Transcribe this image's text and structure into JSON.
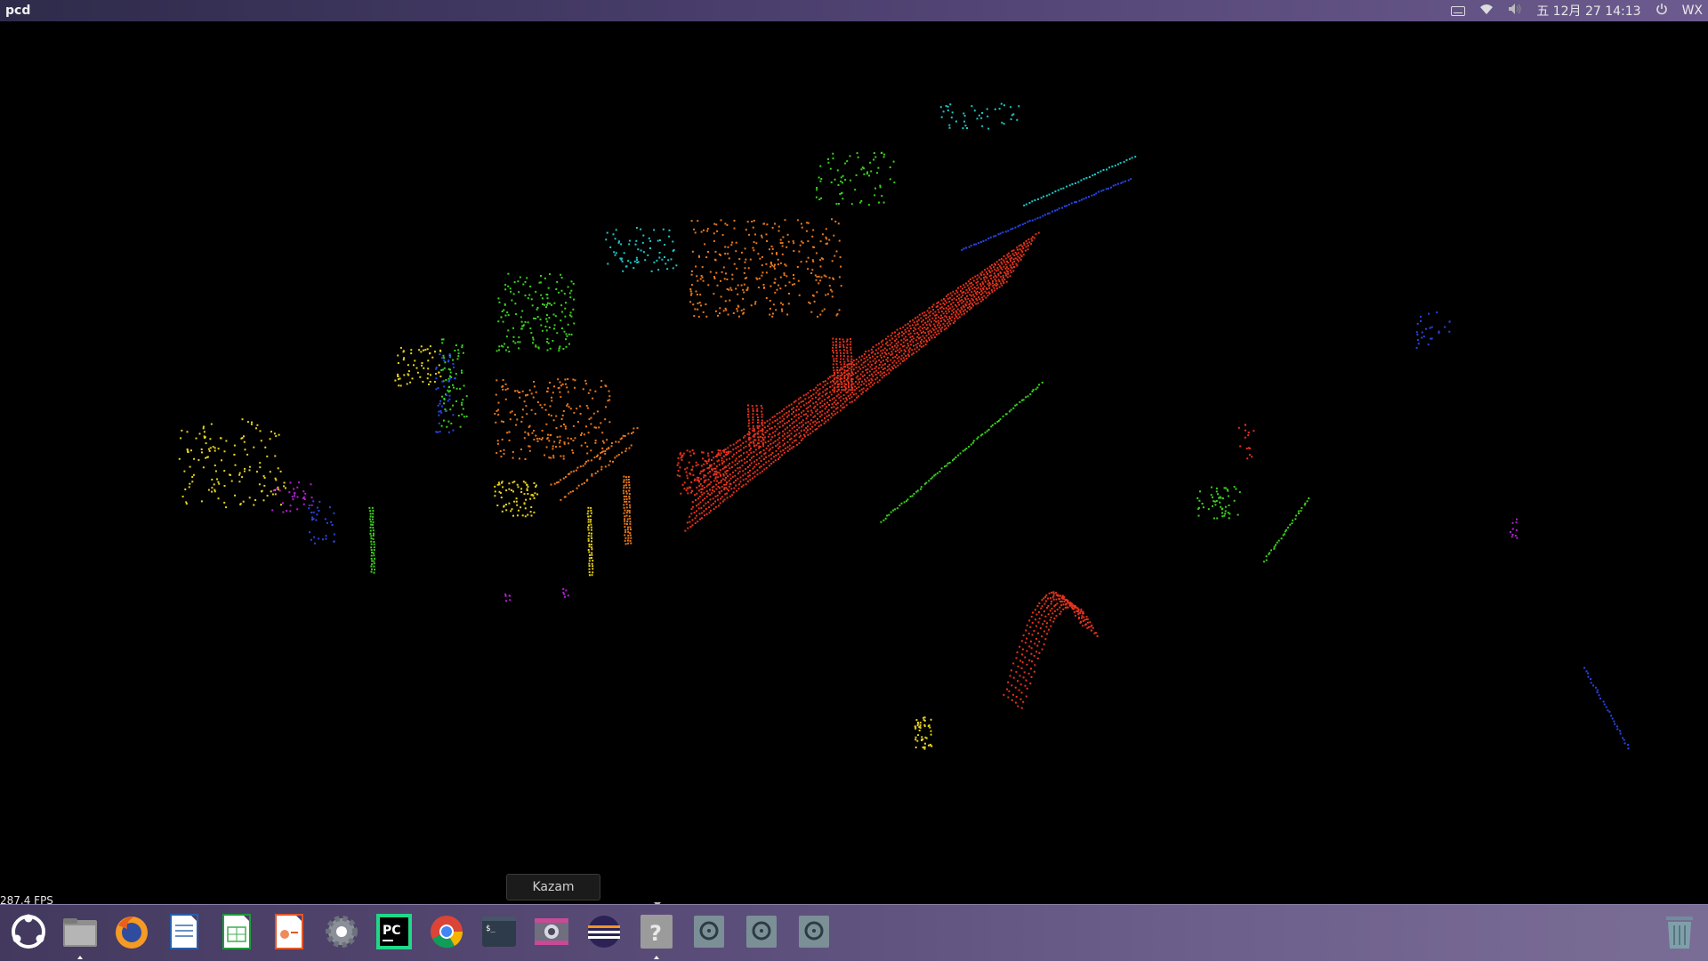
{
  "window": {
    "title": "pcd"
  },
  "top_panel": {
    "indicators": {
      "keyboard_icon": "keyboard-icon",
      "wifi_icon": "wifi-icon",
      "volume_icon": "volume-icon",
      "datetime": "五 12月 27 14:13",
      "power_icon": "power-icon",
      "user": "WX"
    }
  },
  "viewer": {
    "fps": "287.4 FPS",
    "background": "#000000"
  },
  "tooltip": {
    "label": "Kazam"
  },
  "dock": {
    "items": [
      {
        "name": "ubuntu-launcher-icon",
        "active": false
      },
      {
        "name": "files-icon",
        "active": true
      },
      {
        "name": "firefox-icon",
        "active": false
      },
      {
        "name": "libreoffice-writer-icon",
        "active": false
      },
      {
        "name": "libreoffice-calc-icon",
        "active": false
      },
      {
        "name": "libreoffice-impress-icon",
        "active": false
      },
      {
        "name": "settings-icon",
        "active": false
      },
      {
        "name": "pycharm-icon",
        "active": false
      },
      {
        "name": "chrome-icon",
        "active": false
      },
      {
        "name": "terminal-icon",
        "active": false
      },
      {
        "name": "kazam-icon",
        "active": false
      },
      {
        "name": "eclipse-icon",
        "active": false
      },
      {
        "name": "help-icon",
        "active": true
      },
      {
        "name": "disk-icon",
        "active": false
      },
      {
        "name": "disk-icon",
        "active": false
      },
      {
        "name": "disk-icon",
        "active": false
      },
      {
        "name": "trash-icon",
        "active": false
      }
    ]
  },
  "colors": {
    "red": "#e8321c",
    "orange": "#e8781c",
    "yellow": "#e6d21a",
    "green": "#3cd21e",
    "cyan": "#1ec8c8",
    "blue": "#2846e6",
    "magenta": "#b41ed2"
  }
}
